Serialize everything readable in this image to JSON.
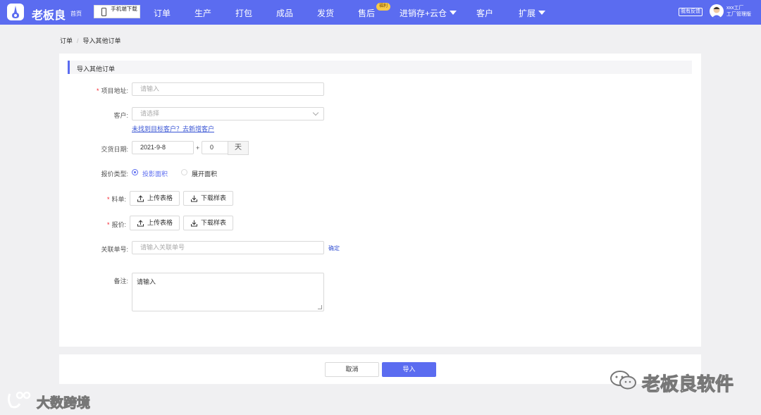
{
  "nav": {
    "brand": "老板良",
    "home": "首页",
    "app_download": "手机端下载",
    "items": [
      "订单",
      "生产",
      "打包",
      "成品",
      "发货",
      "售后",
      "进销存+云仓",
      "客户",
      "扩展"
    ],
    "promo_badge": "福利",
    "feedback": "我有反馈",
    "user_name": "xxx工厂",
    "user_role": "工厂管理版",
    "accent_color": "#5b6cf0"
  },
  "breadcrumb": {
    "root": "订单",
    "separator": "/",
    "current": "导入其他订单"
  },
  "form": {
    "section_title": "导入其他订单",
    "project_address": {
      "label": "项目地址:",
      "placeholder": "请输入"
    },
    "customer": {
      "label": "客户:",
      "placeholder": "请选择",
      "help_link": "未找到目标客户？去新增客户"
    },
    "delivery_date": {
      "label": "交货日期:",
      "date": "2021-9-8",
      "plus": "+",
      "days": "0",
      "unit": "天"
    },
    "quote_type": {
      "label": "报价类型:",
      "options": [
        "投影面积",
        "展开面积"
      ],
      "selected": "投影面积"
    },
    "material_list": {
      "label": "料单:",
      "upload": "上传表格",
      "download": "下载样表"
    },
    "quotation": {
      "label": "报价:",
      "upload": "上传表格",
      "download": "下载样表"
    },
    "related_no": {
      "label": "关联单号:",
      "placeholder": "请输入关联单号",
      "confirm": "确定"
    },
    "remark": {
      "label": "备注:",
      "placeholder": "请输入"
    }
  },
  "actions": {
    "cancel": "取消",
    "import": "导入"
  },
  "watermarks": {
    "right": "老板良软件",
    "left": "大数跨境"
  }
}
